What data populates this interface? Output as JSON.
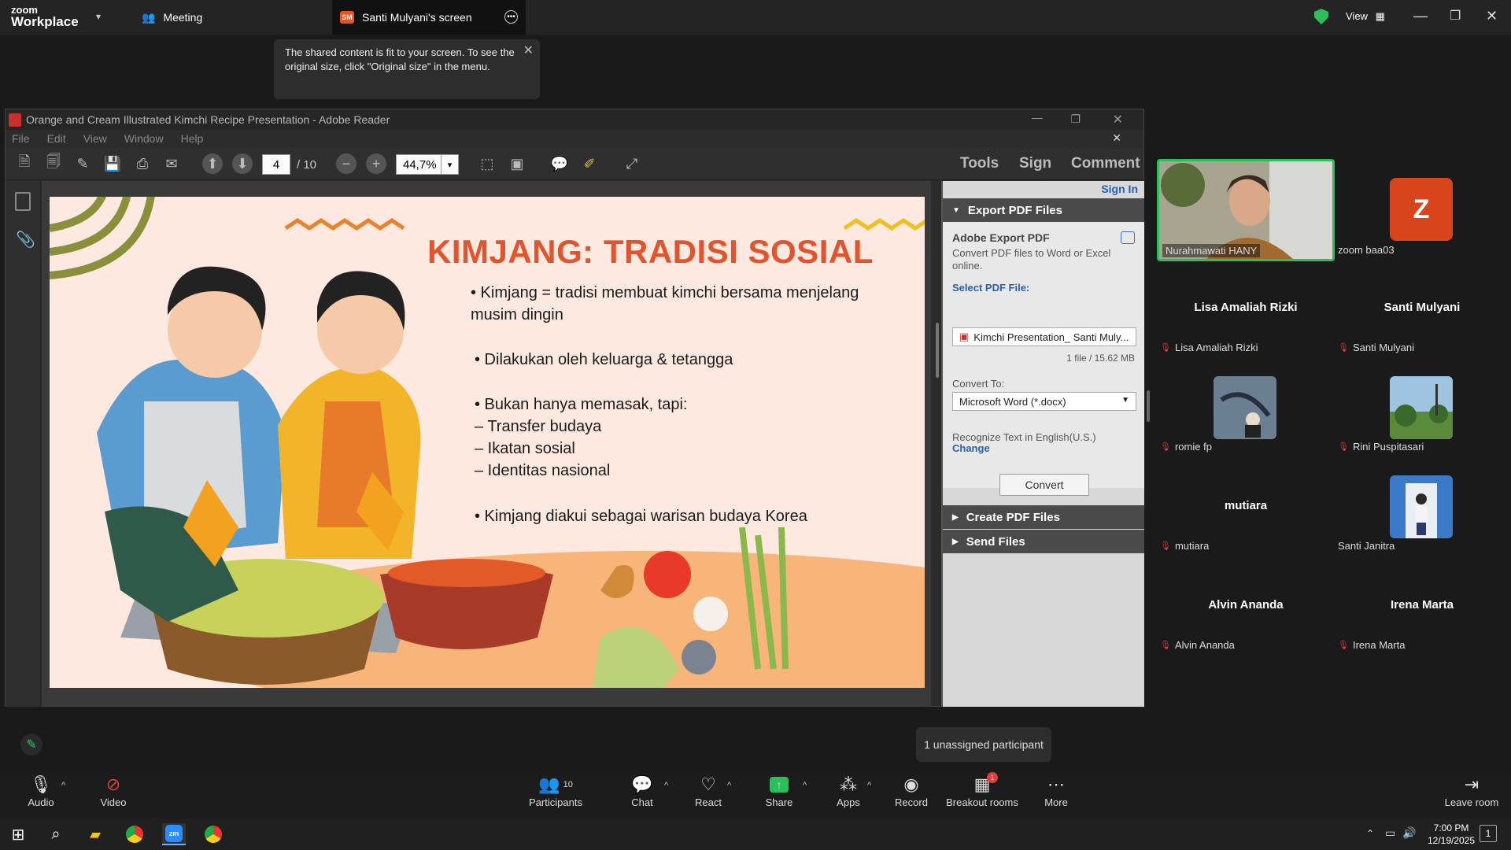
{
  "zoom_header": {
    "logo_line1": "zoom",
    "logo_line2": "Workplace",
    "meeting_tab": "Meeting",
    "share_tab_initials": "SM",
    "share_tab": "Santi Mulyani's screen",
    "view_label": "View"
  },
  "tooltip": {
    "text": "The shared content is fit to your screen. To see the original size, click \"Original size\" in the menu."
  },
  "reader": {
    "title": "Orange and Cream Illustrated Kimchi Recipe Presentation - Adobe Reader",
    "menu": [
      "File",
      "Edit",
      "View",
      "Window",
      "Help"
    ],
    "page_current": "4",
    "page_total": "/ 10",
    "zoom": "44,7%",
    "tools": "Tools",
    "sign": "Sign",
    "comment": "Comment"
  },
  "slide": {
    "title": "KIMJANG: TRADISI SOSIAL",
    "b1": "• Kimjang = tradisi membuat kimchi bersama menjelang",
    "b1b": "musim dingin",
    "b2": "• Dilakukan oleh keluarga & tetangga",
    "b3": "• Bukan hanya memasak, tapi:",
    "b3a": "– Transfer budaya",
    "b3b": "– Ikatan sosial",
    "b3c": "– Identitas nasional",
    "b4": "• Kimjang diakui sebagai warisan budaya Korea"
  },
  "panel": {
    "sign_in": "Sign In",
    "export_header": "Export PDF Files",
    "adobe_export": "Adobe Export PDF",
    "convert_desc": "Convert PDF files to Word or Excel online.",
    "select_label": "Select PDF File:",
    "file_name": "Kimchi Presentation_ Santi Muly...",
    "file_info": "1 file / 15.62 MB",
    "convert_to": "Convert To:",
    "format": "Microsoft Word (*.docx)",
    "recognize": "Recognize Text in English(U.S.)",
    "change": "Change",
    "convert_btn": "Convert",
    "create_header": "Create PDF Files",
    "send_header": "Send Files"
  },
  "gallery": {
    "p1": "Nurahmawati HANY",
    "p2_initial": "Z",
    "p2": "zoom baa03",
    "p3_big": "Lisa Amaliah Rizki",
    "p3": "Lisa Amaliah Rizki",
    "p4_big": "Santi Mulyani",
    "p4": "Santi Mulyani",
    "p5": "romie fp",
    "p6": "Rini Puspitasari",
    "p7_big": "mutiara",
    "p7": "mutiara",
    "p8": "Santi Janitra",
    "p9_big": "Alvin Ananda",
    "p9": "Alvin Ananda",
    "p10_big": "Irena Marta",
    "p10": "Irena Marta"
  },
  "unassigned": "1 unassigned participant",
  "controls": {
    "audio": "Audio",
    "video": "Video",
    "participants": "Participants",
    "participants_count": "10",
    "chat": "Chat",
    "react": "React",
    "share": "Share",
    "apps": "Apps",
    "record": "Record",
    "breakout": "Breakout rooms",
    "breakout_badge": "1",
    "more": "More",
    "leave": "Leave room"
  },
  "taskbar": {
    "time": "7:00 PM",
    "date": "12/19/2025",
    "notif": "1"
  },
  "colors": {
    "accent_green": "#2dbd5a",
    "slide_title": "#e0552d",
    "danger": "#e23d3d"
  }
}
